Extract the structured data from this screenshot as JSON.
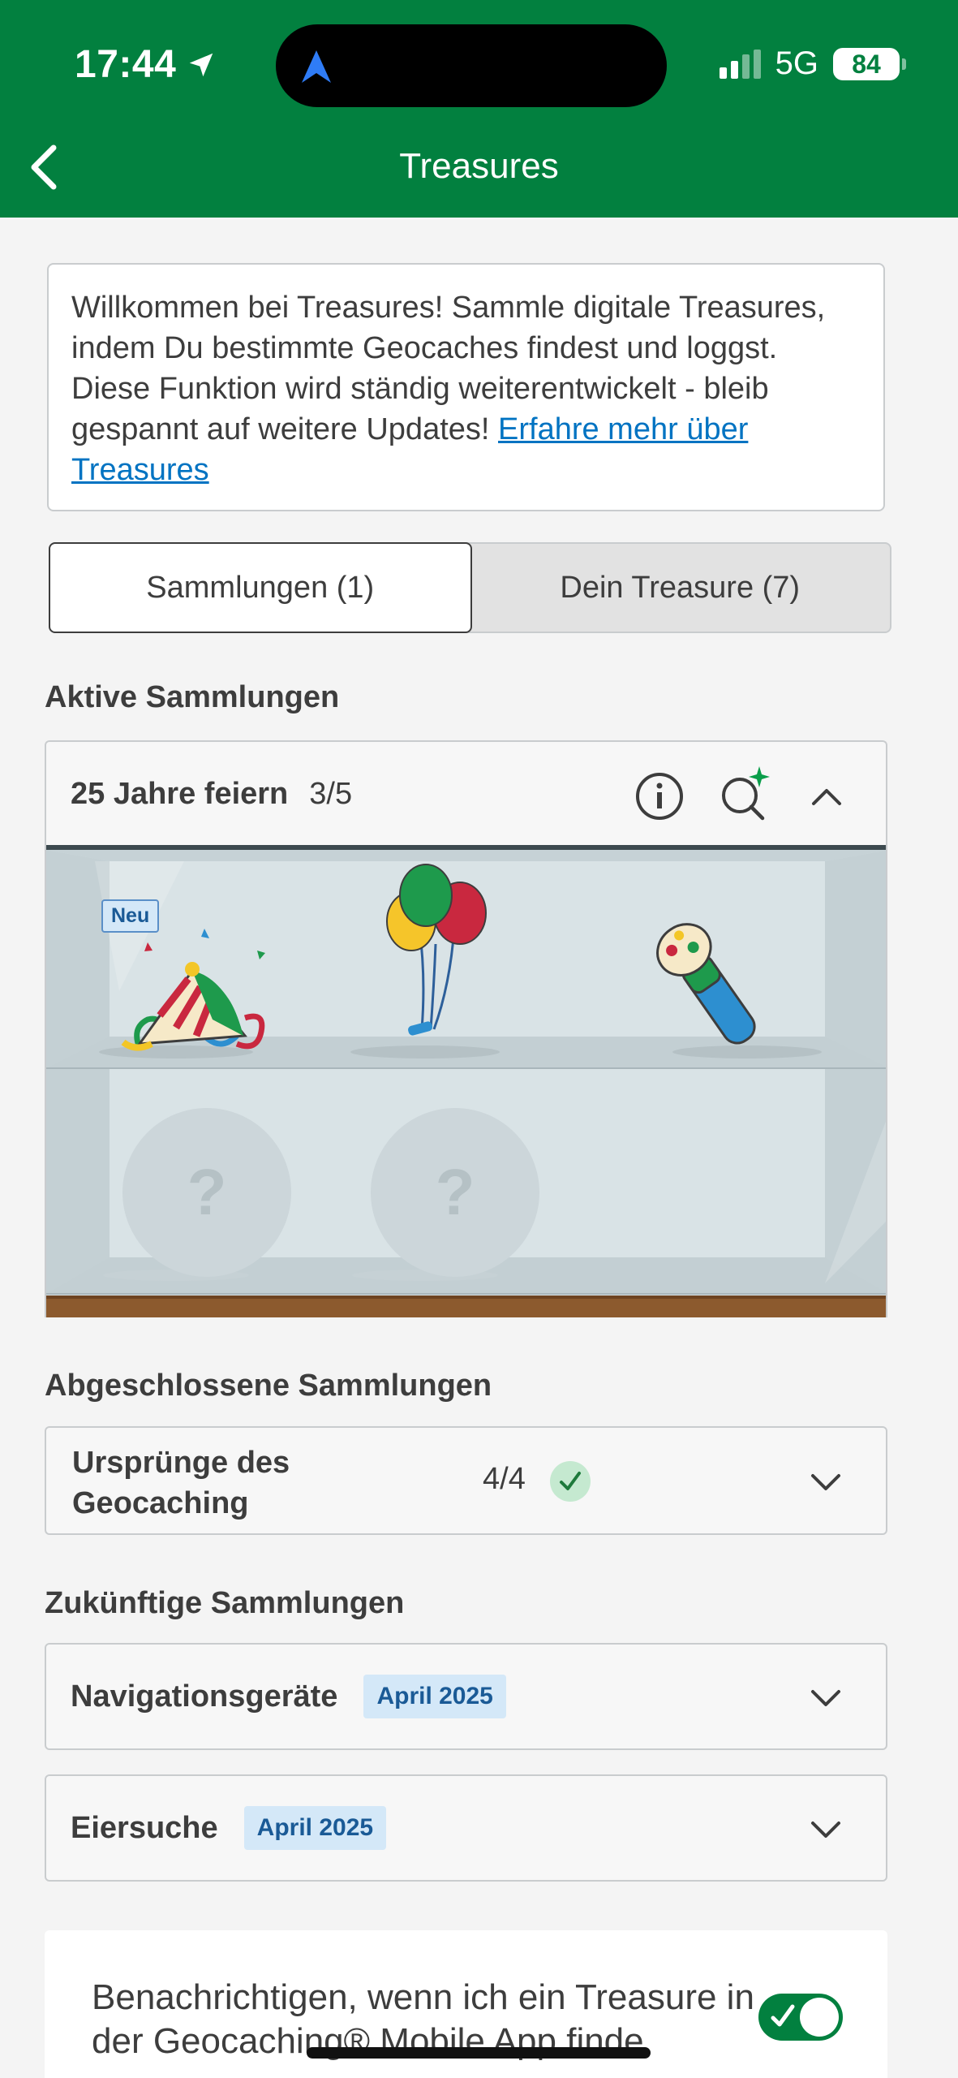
{
  "status_bar": {
    "time": "17:44",
    "network": "5G",
    "battery": "84"
  },
  "header": {
    "title": "Treasures"
  },
  "intro": {
    "text": "Willkommen bei Treasures! Sammle digitale Treasures, indem Du bestimmte Geocaches findest und loggst. Diese Funktion wird ständig weiterentwickelt - bleib gespannt auf weitere Updates! ",
    "link": "Erfahre mehr über Treasures"
  },
  "tabs": [
    {
      "label": "Sammlungen (1)",
      "active": true
    },
    {
      "label": "Dein Treasure (7)",
      "active": false
    }
  ],
  "active": {
    "section_title": "Aktive Sammlungen",
    "collection": {
      "name": "25 Jahre feiern",
      "progress": "3/5"
    },
    "shelf": {
      "new_badge": "Neu",
      "locked_symbol": "?"
    }
  },
  "completed": {
    "section_title": "Abgeschlossene Sammlungen",
    "collection": {
      "name_line1": "Ursprünge des",
      "name_line2": "Geocaching",
      "progress": "4/4"
    }
  },
  "future": {
    "section_title": "Zukünftige Sammlungen",
    "collections": [
      {
        "name": "Navigationsgeräte",
        "badge": "April 2025"
      },
      {
        "name": "Eiersuche",
        "badge": "April 2025"
      }
    ]
  },
  "notify": {
    "text": "Benachrichtigen, wenn ich ein Treasure in der Geocaching® Mobile App finde",
    "enabled": true
  },
  "colors": {
    "brand_green": "#02803f",
    "link_blue": "#0073c2",
    "badge_bg": "#d4e8f8"
  }
}
